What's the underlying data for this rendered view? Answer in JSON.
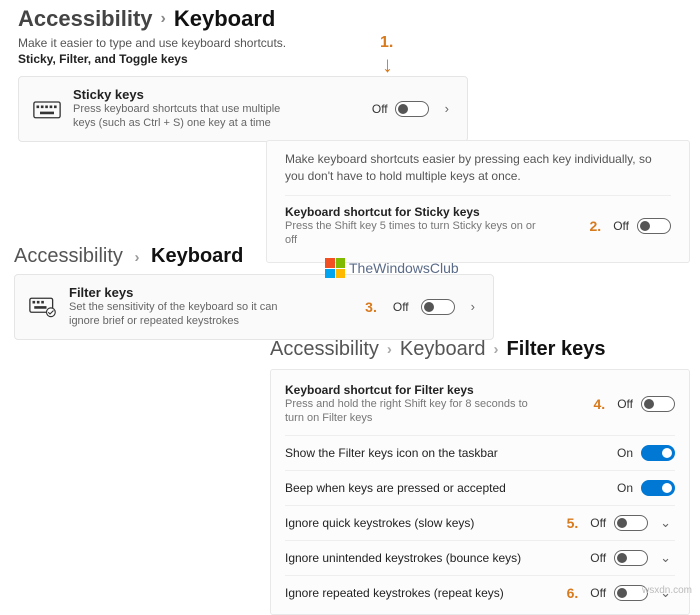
{
  "footer": "wsxdn.com",
  "markers": {
    "m1": "1.",
    "m2": "2.",
    "m3": "3.",
    "m4": "4.",
    "m5": "5.",
    "m6": "6."
  },
  "section1": {
    "crumb1": "Accessibility",
    "crumb2": "Keyboard",
    "sub1": "Make it easier to type and use keyboard shortcuts.",
    "sub2": "Sticky, Filter, and Toggle keys",
    "card": {
      "title": "Sticky keys",
      "desc": "Press keyboard shortcuts that use multiple keys (such as Ctrl + S) one key at a time",
      "state": "Off"
    }
  },
  "section2": {
    "desc": "Make keyboard shortcuts easier by pressing each key individually, so you don't have to hold multiple keys at once.",
    "row": {
      "title": "Keyboard shortcut for Sticky keys",
      "desc": "Press the Shift key 5 times to turn Sticky keys on or off",
      "state": "Off"
    }
  },
  "section3": {
    "crumb1": "Accessibility",
    "crumb2": "Keyboard",
    "card": {
      "title": "Filter keys",
      "desc": "Set the sensitivity of the keyboard so it can ignore brief or repeated keystrokes",
      "state": "Off"
    },
    "twc": "TheWindowsClub"
  },
  "section4": {
    "c1": "Accessibility",
    "c2": "Keyboard",
    "c3": "Filter keys",
    "rows": [
      {
        "title": "Keyboard shortcut for Filter keys",
        "desc": "Press and hold the right Shift key for 8 seconds to turn on Filter keys",
        "state": "Off",
        "on": false,
        "chev": false,
        "mk": "4."
      },
      {
        "title": "Show the Filter keys icon on the taskbar",
        "desc": "",
        "state": "On",
        "on": true,
        "chev": false,
        "mk": ""
      },
      {
        "title": "Beep when keys are pressed or accepted",
        "desc": "",
        "state": "On",
        "on": true,
        "chev": false,
        "mk": ""
      },
      {
        "title": "Ignore quick keystrokes (slow keys)",
        "desc": "",
        "state": "Off",
        "on": false,
        "chev": true,
        "mk": "5."
      },
      {
        "title": "Ignore unintended keystrokes (bounce keys)",
        "desc": "",
        "state": "Off",
        "on": false,
        "chev": true,
        "mk": ""
      },
      {
        "title": "Ignore repeated keystrokes (repeat keys)",
        "desc": "",
        "state": "Off",
        "on": false,
        "chev": true,
        "mk": "6."
      }
    ]
  }
}
